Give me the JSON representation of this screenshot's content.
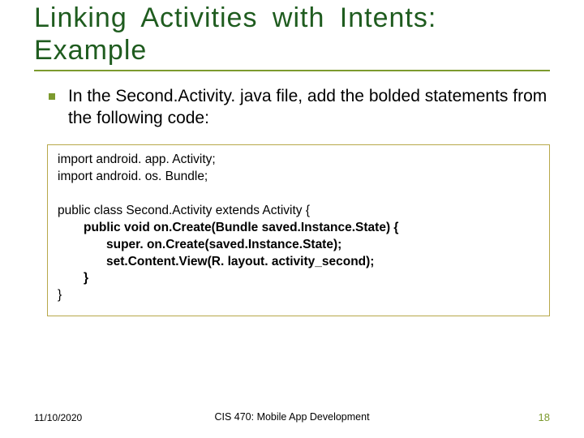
{
  "title": "Linking  Activities  with  Intents: Example",
  "body": {
    "bullet_text": "In the Second.Activity. java file, add the bolded statements from the following code:"
  },
  "code": {
    "l1": "import android. app. Activity;",
    "l2": "import android. os. Bundle;",
    "l3": "public class Second.Activity extends Activity {",
    "l4": "public void on.Create(Bundle saved.Instance.State) {",
    "l5": "super. on.Create(saved.Instance.State);",
    "l6": "set.Content.View(R. layout. activity_second);",
    "l7": "}",
    "l8": "}"
  },
  "footer": {
    "date": "11/10/2020",
    "course": "CIS 470: Mobile App Development",
    "page": "18"
  }
}
